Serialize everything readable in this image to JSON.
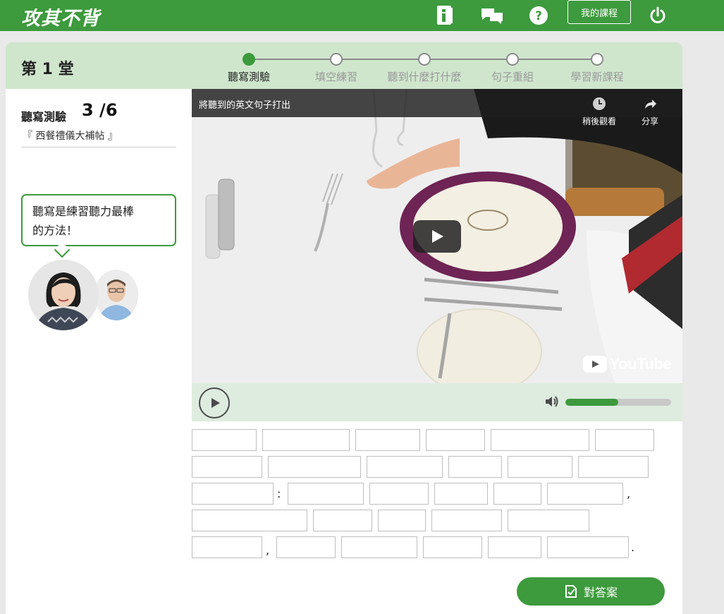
{
  "header": {
    "logo": "攻其不背",
    "my_course_label": "我的課程",
    "icons": [
      "info-book-icon",
      "chat-icon",
      "help-icon",
      "power-icon"
    ],
    "color": "#3d9a3d"
  },
  "lesson": {
    "title": "第 1 堂"
  },
  "steps": [
    {
      "label": "聽寫測驗",
      "active": true
    },
    {
      "label": "填空練習",
      "active": false
    },
    {
      "label": "聽到什麼打什麼",
      "active": false
    },
    {
      "label": "句子重組",
      "active": false
    },
    {
      "label": "學習新課程",
      "active": false
    }
  ],
  "quiz": {
    "title": "聽寫測驗",
    "count": "3 /6",
    "topic": "『 西餐禮儀大補帖 』"
  },
  "bubble": {
    "text_line1": "聽寫是練習聽力最棒",
    "text_line2": "的方法！"
  },
  "video": {
    "title": "將聽到的英文句子打出",
    "watch_later": "稍後觀看",
    "share": "分享",
    "brand": "YouTube",
    "volume": 0.5
  },
  "answer": {
    "punct_colon": ":",
    "punct_comma1": ",",
    "punct_comma2": ",",
    "punct_period": "."
  },
  "check_button": {
    "label": "對答案"
  }
}
